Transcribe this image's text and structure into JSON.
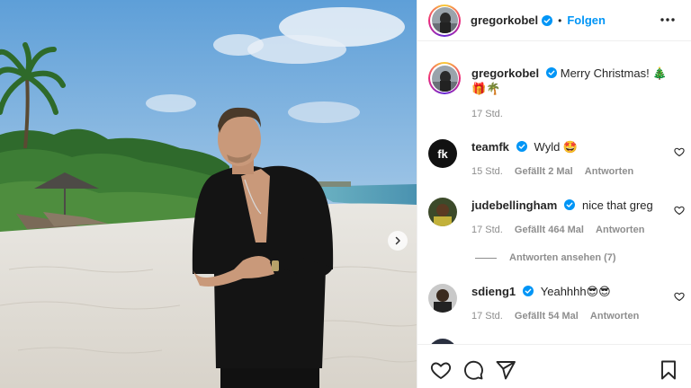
{
  "post": {
    "username": "gregorkobel",
    "follow_label": "Folgen",
    "dot": "•",
    "caption_text": "Merry Christmas! 🎄🎁🌴",
    "caption_time": "17 Std."
  },
  "comments": [
    {
      "username": "teamfk",
      "text": "Wyld 🤩",
      "time": "15 Std.",
      "likes": "Gefällt 2 Mal",
      "reply": "Antworten"
    },
    {
      "username": "judebellingham",
      "text": "nice that greg",
      "time": "17 Std.",
      "likes": "Gefällt 464 Mal",
      "reply": "Antworten"
    },
    {
      "username": "sdieng1",
      "text": "Yeahhhh😎😎",
      "time": "17 Std.",
      "likes": "Gefällt 54 Mal",
      "reply": "Antworten"
    }
  ],
  "view_replies": "Antworten ansehen (7)",
  "colors": {
    "accent": "#0095f6",
    "verified": "#0095f6",
    "muted": "#8e8e8e"
  },
  "icons": [
    "heart-icon",
    "comment-icon",
    "share-icon",
    "bookmark-icon",
    "more-icon",
    "chevron-right-icon",
    "verified-icon"
  ]
}
